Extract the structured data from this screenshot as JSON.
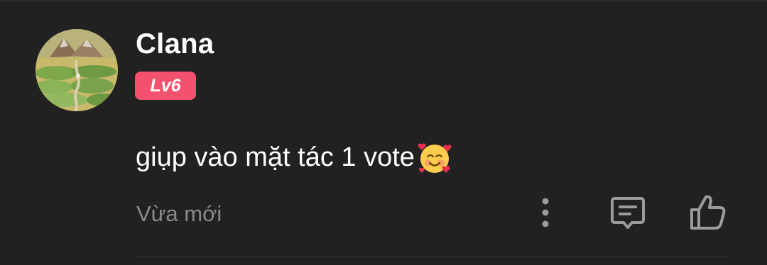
{
  "comment": {
    "username": "Clana",
    "level_badge": "Lv6",
    "text": "giụp vào mặt tác 1 vote",
    "emoji": "smiling-face-with-hearts",
    "timestamp": "Vừa mới"
  },
  "actions": [
    {
      "icon": "more-vertical-icon"
    },
    {
      "icon": "reply-comment-icon"
    },
    {
      "icon": "thumbs-up-icon"
    }
  ],
  "colors": {
    "background": "#212121",
    "badge": "#f3526f",
    "muted_text": "#8a8a8a",
    "icon": "#9b9b9b"
  }
}
